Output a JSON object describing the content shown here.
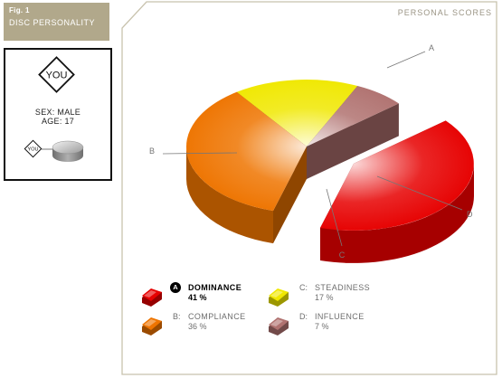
{
  "figure": {
    "number": "Fig. 1",
    "title": "DISC PERSONALITY"
  },
  "profile": {
    "badge": "YOU",
    "small_badge": "YOU",
    "sex": "SEX: MALE",
    "age": "AGE: 17"
  },
  "header": {
    "title": "PERSONAL SCORES"
  },
  "chart_data": {
    "type": "pie",
    "style": "3d-exploded",
    "slices": [
      {
        "letter": "A",
        "name": "DOMINANCE",
        "value": 41,
        "value_label": "41 %",
        "color": "#e60000",
        "exploded": true,
        "selected": true
      },
      {
        "letter": "B",
        "name": "COMPLIANCE",
        "value": 36,
        "value_label": "36 %",
        "color": "#ee7400",
        "exploded": false,
        "selected": false
      },
      {
        "letter": "C",
        "name": "STEADINESS",
        "value": 17,
        "value_label": "17 %",
        "color": "#f0e800",
        "exploded": false,
        "selected": false
      },
      {
        "letter": "D",
        "name": "INFLUENCE",
        "value": 7,
        "value_label": "7 %",
        "color": "#b07270",
        "exploded": false,
        "selected": false
      }
    ],
    "legend": [
      {
        "letter": "A",
        "letter_label": "A",
        "name": "DOMINANCE",
        "value": "41 %",
        "active": true
      },
      {
        "letter": "C",
        "letter_label": "C:",
        "name": "STEADINESS",
        "value": "17 %",
        "active": false
      },
      {
        "letter": "B",
        "letter_label": "B:",
        "name": "COMPLIANCE",
        "value": "36 %",
        "active": false
      },
      {
        "letter": "D",
        "letter_label": "D:",
        "name": "INFLUENCE",
        "value": "7 %",
        "active": false
      }
    ]
  }
}
